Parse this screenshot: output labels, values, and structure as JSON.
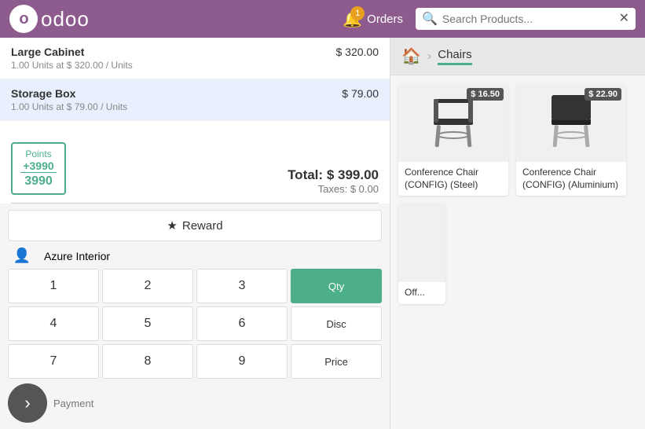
{
  "header": {
    "logo_text": "odoo",
    "orders_label": "Orders",
    "orders_count": "1",
    "search_placeholder": "Search Products..."
  },
  "breadcrumb": {
    "home_icon": "🏠",
    "separator": "›",
    "current": "Chairs"
  },
  "order_items": [
    {
      "name": "Large Cabinet",
      "detail": "1.00 Units at $ 320.00 / Units",
      "price": "$ 320.00"
    },
    {
      "name": "Storage Box",
      "detail": "1.00 Units at $ 79.00 / Units",
      "price": "$ 79.00"
    }
  ],
  "points": {
    "label": "Points",
    "gained": "+3990",
    "total": "3990"
  },
  "totals": {
    "total_label": "Total:",
    "total_value": "$ 399.00",
    "tax_label": "Taxes:",
    "tax_value": "$ 0.00"
  },
  "reward_btn": "★ Reward",
  "customer": {
    "name": "Azure Interior"
  },
  "numpad": {
    "buttons": [
      "1",
      "2",
      "3",
      "4",
      "5",
      "6",
      "7",
      "8",
      "9"
    ],
    "func_buttons": [
      "Qty",
      "Disc",
      "Price"
    ]
  },
  "payment": {
    "arrow": "›",
    "label": "Payment"
  },
  "products": [
    {
      "name": "Conference Chair (CONFIG) (Steel)",
      "price": "$ 16.50"
    },
    {
      "name": "Conference Chair (CONFIG) (Aluminium)",
      "price": "$ 22.90"
    },
    {
      "name": "Off...",
      "price": ""
    }
  ]
}
